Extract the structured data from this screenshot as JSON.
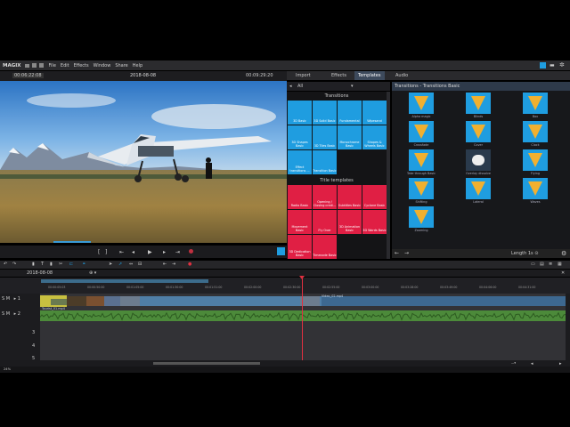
{
  "menu": {
    "logo": "MAGIX",
    "items": [
      "File",
      "Edit",
      "Effects",
      "Window",
      "Share",
      "Help"
    ]
  },
  "preview": {
    "timecode_left": "00:06:22:08",
    "date": "2018-08-08",
    "timecode_right": "00:09:29:20"
  },
  "media_tabs": [
    "Import",
    "Effects",
    "Templates",
    "Audio"
  ],
  "templates": {
    "filter_label": "All",
    "section_transitions": "Transitions",
    "transition_tiles": [
      "3D Basic",
      "3D Solid Basic",
      "Fundamental",
      "Wipesand",
      "3D Shapes Basic",
      "3D Tiles Basic",
      "Monochrome Basic",
      "Shapes & Wheels Basic",
      "Effect transitions ...",
      "Transition Basic"
    ],
    "section_titles": "Title templates",
    "title_tiles": [
      "Radio Basic",
      "Opening / Closing credi...",
      "Subtitles Basic",
      "Cyclone Basic",
      "Movement Basic",
      "Fly Over",
      "3D Animation Basic",
      "3D Words Basic",
      "3D Dedication Basic",
      "Timecode Basic"
    ]
  },
  "transitions_panel": {
    "breadcrumb": "Transitions - Transitions Basic",
    "items": [
      "Alpha magic",
      "Blinds",
      "Box",
      "Crossfade",
      "Cover",
      "Clock",
      "Take through Basic",
      "Overlay dissolve",
      "Flying",
      "Shifting",
      "Lateral",
      "Waves",
      "Zooming"
    ],
    "footer_label": "Length 1s ⊙"
  },
  "timeline": {
    "date": "2018-08-08",
    "ruler": [
      "00:00:05:03",
      "00:00:50:00",
      "00:01:05:00",
      "00:01:30:00",
      "00:01:51:00",
      "00:02:00:00",
      "00:02:30:00",
      "00:02:55:00",
      "00:03:00:00",
      "00:03:28:00",
      "00:03:49:00",
      "00:04:06:00",
      "00:04:31:00"
    ],
    "clip_label_1": "Tourist_01.mp4",
    "clip_label_2": "Video_02.mp4",
    "tracks": [
      "1",
      "2",
      "3",
      "4",
      "5"
    ],
    "zoom": "24%"
  },
  "colors": {
    "accent": "#1f9de0",
    "title_red": "#e01f44",
    "playhead": "#e03040"
  }
}
